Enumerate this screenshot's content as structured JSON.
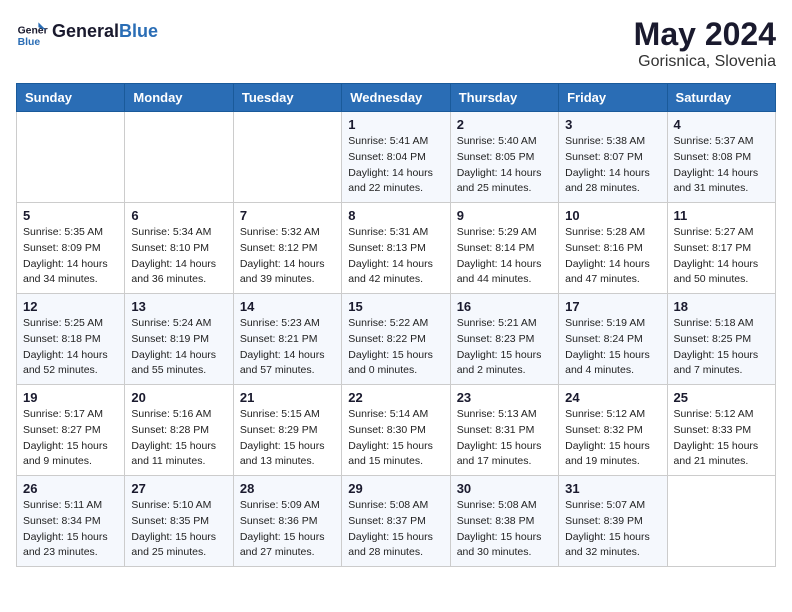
{
  "header": {
    "logo_line1": "General",
    "logo_line2": "Blue",
    "month_year": "May 2024",
    "location": "Gorisnica, Slovenia"
  },
  "weekdays": [
    "Sunday",
    "Monday",
    "Tuesday",
    "Wednesday",
    "Thursday",
    "Friday",
    "Saturday"
  ],
  "weeks": [
    [
      null,
      null,
      null,
      {
        "day": 1,
        "sunrise": "5:41 AM",
        "sunset": "8:04 PM",
        "daylight": "14 hours and 22 minutes."
      },
      {
        "day": 2,
        "sunrise": "5:40 AM",
        "sunset": "8:05 PM",
        "daylight": "14 hours and 25 minutes."
      },
      {
        "day": 3,
        "sunrise": "5:38 AM",
        "sunset": "8:07 PM",
        "daylight": "14 hours and 28 minutes."
      },
      {
        "day": 4,
        "sunrise": "5:37 AM",
        "sunset": "8:08 PM",
        "daylight": "14 hours and 31 minutes."
      }
    ],
    [
      {
        "day": 5,
        "sunrise": "5:35 AM",
        "sunset": "8:09 PM",
        "daylight": "14 hours and 34 minutes."
      },
      {
        "day": 6,
        "sunrise": "5:34 AM",
        "sunset": "8:10 PM",
        "daylight": "14 hours and 36 minutes."
      },
      {
        "day": 7,
        "sunrise": "5:32 AM",
        "sunset": "8:12 PM",
        "daylight": "14 hours and 39 minutes."
      },
      {
        "day": 8,
        "sunrise": "5:31 AM",
        "sunset": "8:13 PM",
        "daylight": "14 hours and 42 minutes."
      },
      {
        "day": 9,
        "sunrise": "5:29 AM",
        "sunset": "8:14 PM",
        "daylight": "14 hours and 44 minutes."
      },
      {
        "day": 10,
        "sunrise": "5:28 AM",
        "sunset": "8:16 PM",
        "daylight": "14 hours and 47 minutes."
      },
      {
        "day": 11,
        "sunrise": "5:27 AM",
        "sunset": "8:17 PM",
        "daylight": "14 hours and 50 minutes."
      }
    ],
    [
      {
        "day": 12,
        "sunrise": "5:25 AM",
        "sunset": "8:18 PM",
        "daylight": "14 hours and 52 minutes."
      },
      {
        "day": 13,
        "sunrise": "5:24 AM",
        "sunset": "8:19 PM",
        "daylight": "14 hours and 55 minutes."
      },
      {
        "day": 14,
        "sunrise": "5:23 AM",
        "sunset": "8:21 PM",
        "daylight": "14 hours and 57 minutes."
      },
      {
        "day": 15,
        "sunrise": "5:22 AM",
        "sunset": "8:22 PM",
        "daylight": "15 hours and 0 minutes."
      },
      {
        "day": 16,
        "sunrise": "5:21 AM",
        "sunset": "8:23 PM",
        "daylight": "15 hours and 2 minutes."
      },
      {
        "day": 17,
        "sunrise": "5:19 AM",
        "sunset": "8:24 PM",
        "daylight": "15 hours and 4 minutes."
      },
      {
        "day": 18,
        "sunrise": "5:18 AM",
        "sunset": "8:25 PM",
        "daylight": "15 hours and 7 minutes."
      }
    ],
    [
      {
        "day": 19,
        "sunrise": "5:17 AM",
        "sunset": "8:27 PM",
        "daylight": "15 hours and 9 minutes."
      },
      {
        "day": 20,
        "sunrise": "5:16 AM",
        "sunset": "8:28 PM",
        "daylight": "15 hours and 11 minutes."
      },
      {
        "day": 21,
        "sunrise": "5:15 AM",
        "sunset": "8:29 PM",
        "daylight": "15 hours and 13 minutes."
      },
      {
        "day": 22,
        "sunrise": "5:14 AM",
        "sunset": "8:30 PM",
        "daylight": "15 hours and 15 minutes."
      },
      {
        "day": 23,
        "sunrise": "5:13 AM",
        "sunset": "8:31 PM",
        "daylight": "15 hours and 17 minutes."
      },
      {
        "day": 24,
        "sunrise": "5:12 AM",
        "sunset": "8:32 PM",
        "daylight": "15 hours and 19 minutes."
      },
      {
        "day": 25,
        "sunrise": "5:12 AM",
        "sunset": "8:33 PM",
        "daylight": "15 hours and 21 minutes."
      }
    ],
    [
      {
        "day": 26,
        "sunrise": "5:11 AM",
        "sunset": "8:34 PM",
        "daylight": "15 hours and 23 minutes."
      },
      {
        "day": 27,
        "sunrise": "5:10 AM",
        "sunset": "8:35 PM",
        "daylight": "15 hours and 25 minutes."
      },
      {
        "day": 28,
        "sunrise": "5:09 AM",
        "sunset": "8:36 PM",
        "daylight": "15 hours and 27 minutes."
      },
      {
        "day": 29,
        "sunrise": "5:08 AM",
        "sunset": "8:37 PM",
        "daylight": "15 hours and 28 minutes."
      },
      {
        "day": 30,
        "sunrise": "5:08 AM",
        "sunset": "8:38 PM",
        "daylight": "15 hours and 30 minutes."
      },
      {
        "day": 31,
        "sunrise": "5:07 AM",
        "sunset": "8:39 PM",
        "daylight": "15 hours and 32 minutes."
      },
      null
    ]
  ]
}
